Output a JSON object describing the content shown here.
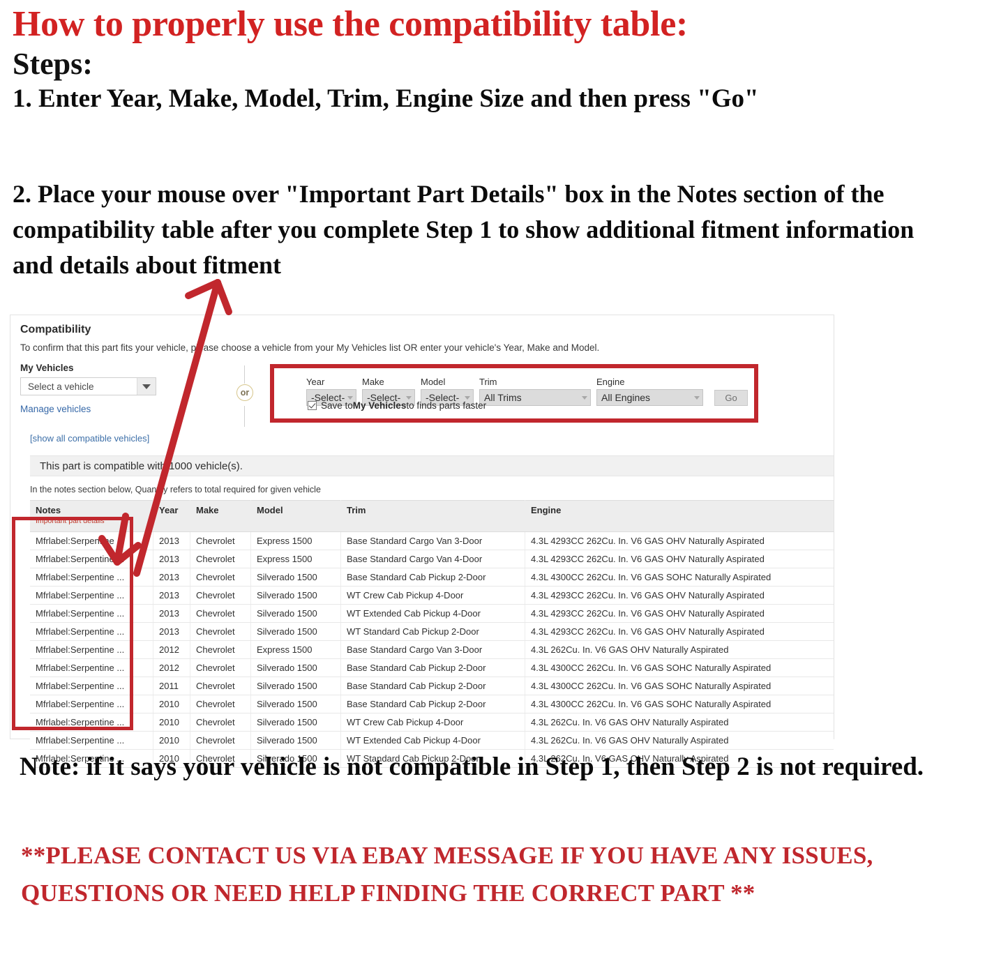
{
  "headline": {
    "title": "How to properly use the compatibility table:",
    "steps_label": "Steps:",
    "step_one": "1. Enter Year, Make, Model, Trim, Engine Size and then press \"Go\"",
    "step_two": "2. Place your mouse over \"Important Part Details\" box in the Notes section of the compatibility table after you complete Step 1 to show additional fitment information and details about fitment"
  },
  "colors": {
    "red_heading": "#d22222",
    "red_box": "#c1272d",
    "link_blue": "#3668a8",
    "banner_gray": "#f1f1f1"
  },
  "compatibility": {
    "title": "Compatibility",
    "subtitle": "To confirm that this part fits your vehicle, please choose a vehicle from your My Vehicles list OR enter your vehicle's Year, Make and Model.",
    "my_vehicles": {
      "label": "My Vehicles",
      "select_value": "Select a vehicle",
      "manage_link": "Manage vehicles",
      "show_all_link": "[show all compatible vehicles]"
    },
    "or_separator": "or",
    "form": {
      "year": {
        "label": "Year",
        "value": "-Select-"
      },
      "make": {
        "label": "Make",
        "value": "-Select-"
      },
      "model": {
        "label": "Model",
        "value": "-Select-"
      },
      "trim": {
        "label": "Trim",
        "value": "All Trims"
      },
      "engine": {
        "label": "Engine",
        "value": "All Engines"
      },
      "go_button": "Go",
      "save_checkbox": {
        "checked": true,
        "prefix": "Save to ",
        "bold": "My Vehicles",
        "suffix": " to finds parts faster"
      }
    },
    "banner": "This part is compatible with 1000 vehicle(s).",
    "qty_note": "In the notes section below, Quantity refers to total required for given vehicle"
  },
  "table": {
    "headers": {
      "notes": "Notes",
      "notes_sub": "Important part details",
      "year": "Year",
      "make": "Make",
      "model": "Model",
      "trim": "Trim",
      "engine": "Engine"
    },
    "rows": [
      {
        "notes": "Mfrlabel:Serpentine ...",
        "year": "2013",
        "make": "Chevrolet",
        "model": "Express 1500",
        "trim": "Base Standard Cargo Van 3-Door",
        "engine": "4.3L 4293CC 262Cu. In. V6 GAS OHV Naturally Aspirated"
      },
      {
        "notes": "Mfrlabel:Serpentine ...",
        "year": "2013",
        "make": "Chevrolet",
        "model": "Express 1500",
        "trim": "Base Standard Cargo Van 4-Door",
        "engine": "4.3L 4293CC 262Cu. In. V6 GAS OHV Naturally Aspirated"
      },
      {
        "notes": "Mfrlabel:Serpentine ...",
        "year": "2013",
        "make": "Chevrolet",
        "model": "Silverado 1500",
        "trim": "Base Standard Cab Pickup 2-Door",
        "engine": "4.3L 4300CC 262Cu. In. V6 GAS SOHC Naturally Aspirated"
      },
      {
        "notes": "Mfrlabel:Serpentine ...",
        "year": "2013",
        "make": "Chevrolet",
        "model": "Silverado 1500",
        "trim": "WT Crew Cab Pickup 4-Door",
        "engine": "4.3L 4293CC 262Cu. In. V6 GAS OHV Naturally Aspirated"
      },
      {
        "notes": "Mfrlabel:Serpentine ...",
        "year": "2013",
        "make": "Chevrolet",
        "model": "Silverado 1500",
        "trim": "WT Extended Cab Pickup 4-Door",
        "engine": "4.3L 4293CC 262Cu. In. V6 GAS OHV Naturally Aspirated"
      },
      {
        "notes": "Mfrlabel:Serpentine ...",
        "year": "2013",
        "make": "Chevrolet",
        "model": "Silverado 1500",
        "trim": "WT Standard Cab Pickup 2-Door",
        "engine": "4.3L 4293CC 262Cu. In. V6 GAS OHV Naturally Aspirated"
      },
      {
        "notes": "Mfrlabel:Serpentine ...",
        "year": "2012",
        "make": "Chevrolet",
        "model": "Express 1500",
        "trim": "Base Standard Cargo Van 3-Door",
        "engine": "4.3L 262Cu. In. V6 GAS OHV Naturally Aspirated"
      },
      {
        "notes": "Mfrlabel:Serpentine ...",
        "year": "2012",
        "make": "Chevrolet",
        "model": "Silverado 1500",
        "trim": "Base Standard Cab Pickup 2-Door",
        "engine": "4.3L 4300CC 262Cu. In. V6 GAS SOHC Naturally Aspirated"
      },
      {
        "notes": "Mfrlabel:Serpentine ...",
        "year": "2011",
        "make": "Chevrolet",
        "model": "Silverado 1500",
        "trim": "Base Standard Cab Pickup 2-Door",
        "engine": "4.3L 4300CC 262Cu. In. V6 GAS SOHC Naturally Aspirated"
      },
      {
        "notes": "Mfrlabel:Serpentine ...",
        "year": "2010",
        "make": "Chevrolet",
        "model": "Silverado 1500",
        "trim": "Base Standard Cab Pickup 2-Door",
        "engine": "4.3L 4300CC 262Cu. In. V6 GAS SOHC Naturally Aspirated"
      },
      {
        "notes": "Mfrlabel:Serpentine ...",
        "year": "2010",
        "make": "Chevrolet",
        "model": "Silverado 1500",
        "trim": "WT Crew Cab Pickup 4-Door",
        "engine": "4.3L 262Cu. In. V6 GAS OHV Naturally Aspirated"
      },
      {
        "notes": "Mfrlabel:Serpentine ...",
        "year": "2010",
        "make": "Chevrolet",
        "model": "Silverado 1500",
        "trim": "WT Extended Cab Pickup 4-Door",
        "engine": "4.3L 262Cu. In. V6 GAS OHV Naturally Aspirated"
      },
      {
        "notes": "Mfrlabel:Serpentine ...",
        "year": "2010",
        "make": "Chevrolet",
        "model": "Silverado 1500",
        "trim": "WT Standard Cab Pickup 2-Door",
        "engine": "4.3L 262Cu. In. V6 GAS OHV Naturally Aspirated"
      }
    ]
  },
  "footer": {
    "note": "Note: if it says your vehicle is not compatible in Step 1, then Step 2 is not required.",
    "contact": "**PLEASE CONTACT US VIA EBAY MESSAGE IF YOU HAVE ANY ISSUES, QUESTIONS OR NEED HELP FINDING THE CORRECT PART **"
  }
}
